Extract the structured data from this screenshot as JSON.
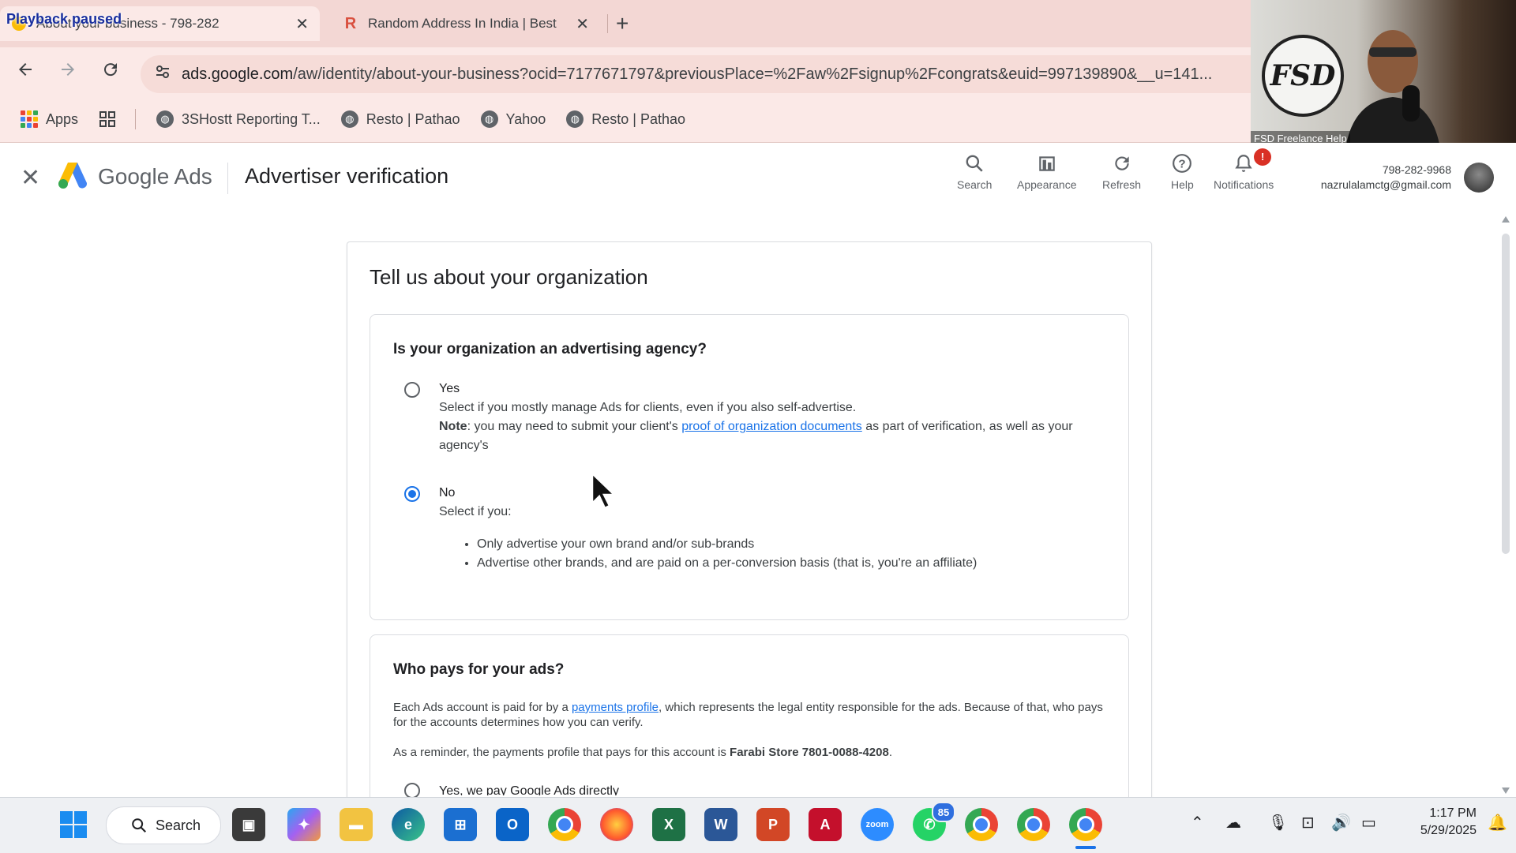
{
  "browser": {
    "playback_status": "Playback paused",
    "tabs": [
      {
        "title": "About your business - 798-282",
        "close": "✕"
      },
      {
        "favicon": "R",
        "title": "Random Address In India | Best",
        "close": "✕"
      }
    ],
    "new_tab": "+",
    "url_host": "ads.google.com",
    "url_path": "/aw/identity/about-your-business?ocid=7177671797&previousPlace=%2Faw%2Fsignup%2Fcongrats&euid=997139890&__u=141...",
    "bookmarks": [
      "Apps",
      "3SHostt Reporting T...",
      "Resto | Pathao",
      "Yahoo",
      "Resto | Pathao"
    ]
  },
  "webcam": {
    "logo_text": "FSD",
    "logo_subtext": "fsd freelance help",
    "caption": "FSD Freelance Help"
  },
  "ads_header": {
    "brand": "Google Ads",
    "title": "Advertiser verification",
    "actions": [
      {
        "label": "Search",
        "icon": "search-icon"
      },
      {
        "label": "Appearance",
        "icon": "appearance-icon"
      },
      {
        "label": "Refresh",
        "icon": "refresh-icon"
      },
      {
        "label": "Help",
        "icon": "help-icon"
      },
      {
        "label": "Notifications",
        "icon": "bell-icon",
        "badge": "!"
      }
    ],
    "account_id": "798-282-9968",
    "account_email": "nazrulalamctg@gmail.com"
  },
  "form": {
    "title": "Tell us about your organization",
    "agency": {
      "question": "Is your organization an advertising agency?",
      "yes": {
        "label": "Yes",
        "desc": "Select if you mostly manage Ads for clients, even if you also self-advertise.",
        "note_label": "Note",
        "note_pre": ": you may need to submit your client's ",
        "note_link": "proof of organization documents",
        "note_post": " as part of verification, as well as your agency's",
        "selected": false
      },
      "no": {
        "label": "No",
        "desc": "Select if you:",
        "bullets": [
          "Only advertise your own brand and/or sub-brands",
          "Advertise other brands, and are paid on a per-conversion basis (that is, you're an affiliate)"
        ],
        "selected": true
      }
    },
    "payer": {
      "question": "Who pays for your ads?",
      "desc_pre": "Each Ads account is paid for by a ",
      "desc_link": "payments profile",
      "desc_post": ", which represents the legal entity responsible for the ads. Because of that, who pays for the accounts determines how you can verify.",
      "reminder_pre": "As a reminder, the payments profile that pays for this account is ",
      "reminder_bold": "Farabi Store 7801-0088-4208",
      "reminder_post": ".",
      "option_partial": "Yes, we pay Google Ads directly"
    }
  },
  "taskbar": {
    "search_label": "Search",
    "whatsapp_badge": "85",
    "time": "1:17 PM",
    "date": "5/29/2025"
  },
  "colors": {
    "accent": "#1a73e8",
    "tabstrip": "#f3d7d4",
    "badge_red": "#d93025"
  }
}
